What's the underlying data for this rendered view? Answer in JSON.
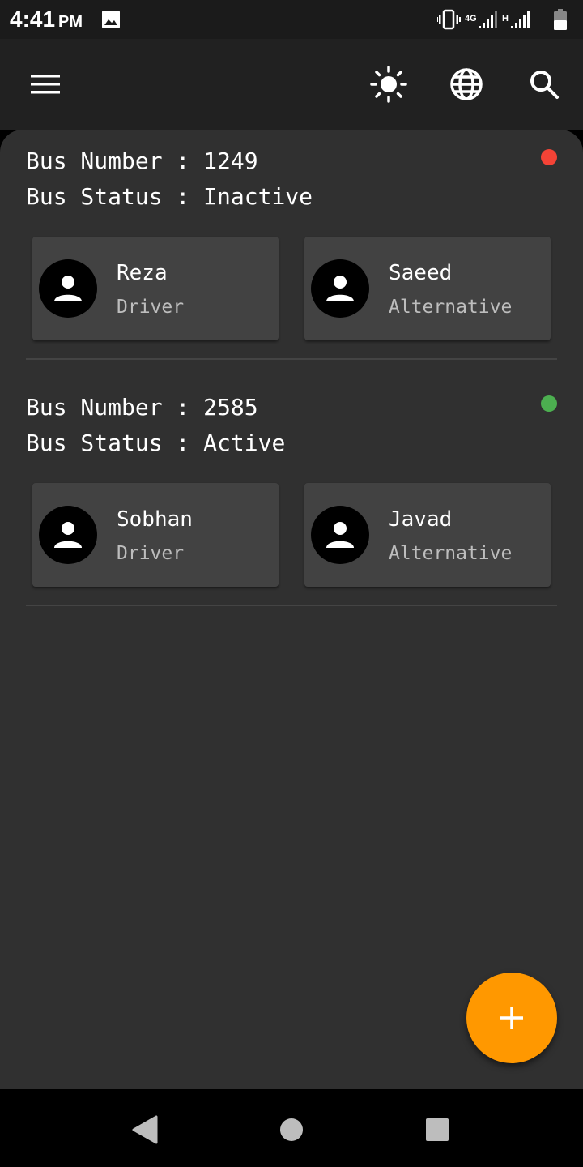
{
  "status_bar": {
    "time": "4:41",
    "ampm": "PM",
    "network_label_1": "4G",
    "network_label_2": "H"
  },
  "app_bar": {
    "icons": [
      "menu-icon",
      "brightness-icon",
      "globe-icon",
      "search-icon"
    ]
  },
  "buses": [
    {
      "number_label": "Bus Number : ",
      "number": "1249",
      "status_label": "Bus Status : ",
      "status": "Inactive",
      "status_color": "#f44336",
      "driver": {
        "name": "Reza",
        "role": "Driver"
      },
      "alternative": {
        "name": "Saeed",
        "role": "Alternative"
      }
    },
    {
      "number_label": "Bus Number : ",
      "number": "2585",
      "status_label": "Bus Status : ",
      "status": "Active",
      "status_color": "#4caf50",
      "driver": {
        "name": "Sobhan",
        "role": "Driver"
      },
      "alternative": {
        "name": "Javad",
        "role": "Alternative"
      }
    }
  ],
  "fab": {
    "icon": "add-icon",
    "color": "#ff9800"
  },
  "nav_bar": {
    "icons": [
      "back-icon",
      "home-icon",
      "recents-icon"
    ]
  }
}
